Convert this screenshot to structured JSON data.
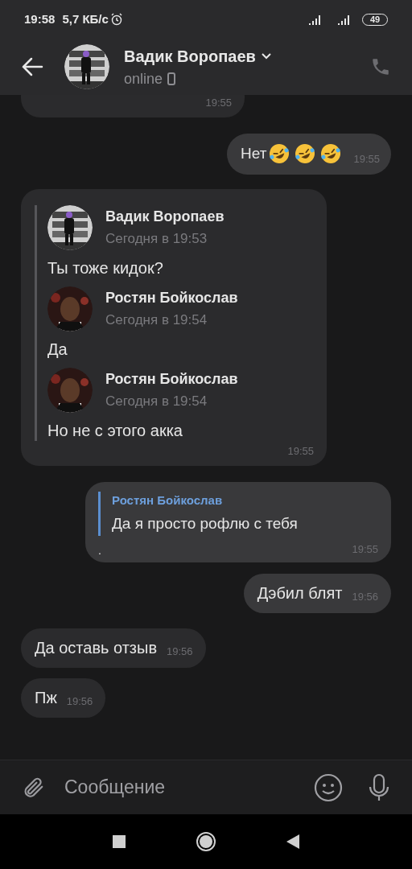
{
  "status_bar": {
    "time": "19:58",
    "speed": "5,7 КБ/с",
    "battery": "49"
  },
  "header": {
    "name": "Вадик Воропаев",
    "status": "online"
  },
  "messages": [
    {
      "kind": "partial",
      "outgoing": false,
      "time": "19:55"
    },
    {
      "kind": "emoji",
      "outgoing": true,
      "text": "Нет",
      "emojis": [
        {
          "kind": "rofl"
        },
        {
          "kind": "rofl"
        },
        {
          "kind": "rofl"
        }
      ],
      "time": "19:55"
    },
    {
      "kind": "forward",
      "outgoing": false,
      "time": "19:55",
      "items": [
        {
          "author": "Вадик Воропаев",
          "avatar": {
            "kind": "dark"
          },
          "date": "Сегодня в 19:53",
          "text": "Ты тоже кидок?"
        },
        {
          "author": "Ростян Бойкослав",
          "avatar": {
            "kind": "light"
          },
          "date": "Сегодня в 19:54",
          "text": "Да"
        },
        {
          "author": "Ростян Бойкослав",
          "avatar": {
            "kind": "light"
          },
          "date": "Сегодня в 19:54",
          "text": "Но не с этого акка"
        }
      ]
    },
    {
      "kind": "reply",
      "outgoing": true,
      "quote_author": "Ростян Бойкослав",
      "quote_text": "Да я просто рофлю с тебя",
      "text": ".",
      "time": "19:55"
    },
    {
      "kind": "text",
      "outgoing": true,
      "text": "Дэбил блят",
      "time": "19:56"
    },
    {
      "kind": "text",
      "outgoing": false,
      "text": "Да оставь отзыв",
      "time": "19:56"
    },
    {
      "kind": "text",
      "outgoing": false,
      "text": "Пж",
      "time": "19:56"
    }
  ],
  "composer": {
    "placeholder": "Сообщение"
  }
}
